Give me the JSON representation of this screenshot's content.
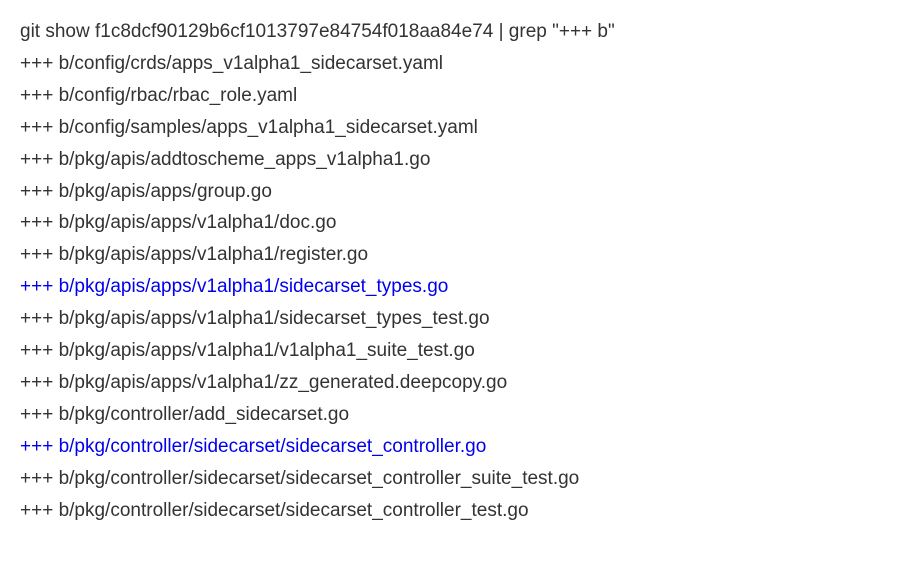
{
  "command": "git show f1c8dcf90129b6cf1013797e84754f018aa84e74 | grep \"+++ b\"",
  "lines": [
    {
      "text": "+++ b/config/crds/apps_v1alpha1_sidecarset.yaml",
      "highlight": false
    },
    {
      "text": "+++ b/config/rbac/rbac_role.yaml",
      "highlight": false
    },
    {
      "text": "+++ b/config/samples/apps_v1alpha1_sidecarset.yaml",
      "highlight": false
    },
    {
      "text": "+++ b/pkg/apis/addtoscheme_apps_v1alpha1.go",
      "highlight": false
    },
    {
      "text": "+++ b/pkg/apis/apps/group.go",
      "highlight": false
    },
    {
      "text": "+++ b/pkg/apis/apps/v1alpha1/doc.go",
      "highlight": false
    },
    {
      "text": "+++ b/pkg/apis/apps/v1alpha1/register.go",
      "highlight": false
    },
    {
      "text": "+++ b/pkg/apis/apps/v1alpha1/sidecarset_types.go",
      "highlight": true
    },
    {
      "text": "+++ b/pkg/apis/apps/v1alpha1/sidecarset_types_test.go",
      "highlight": false
    },
    {
      "text": "+++ b/pkg/apis/apps/v1alpha1/v1alpha1_suite_test.go",
      "highlight": false
    },
    {
      "text": "+++ b/pkg/apis/apps/v1alpha1/zz_generated.deepcopy.go",
      "highlight": false
    },
    {
      "text": "+++ b/pkg/controller/add_sidecarset.go",
      "highlight": false
    },
    {
      "text": "+++ b/pkg/controller/sidecarset/sidecarset_controller.go",
      "highlight": true
    },
    {
      "text": "+++ b/pkg/controller/sidecarset/sidecarset_controller_suite_test.go",
      "highlight": false
    },
    {
      "text": "+++ b/pkg/controller/sidecarset/sidecarset_controller_test.go",
      "highlight": false
    }
  ]
}
